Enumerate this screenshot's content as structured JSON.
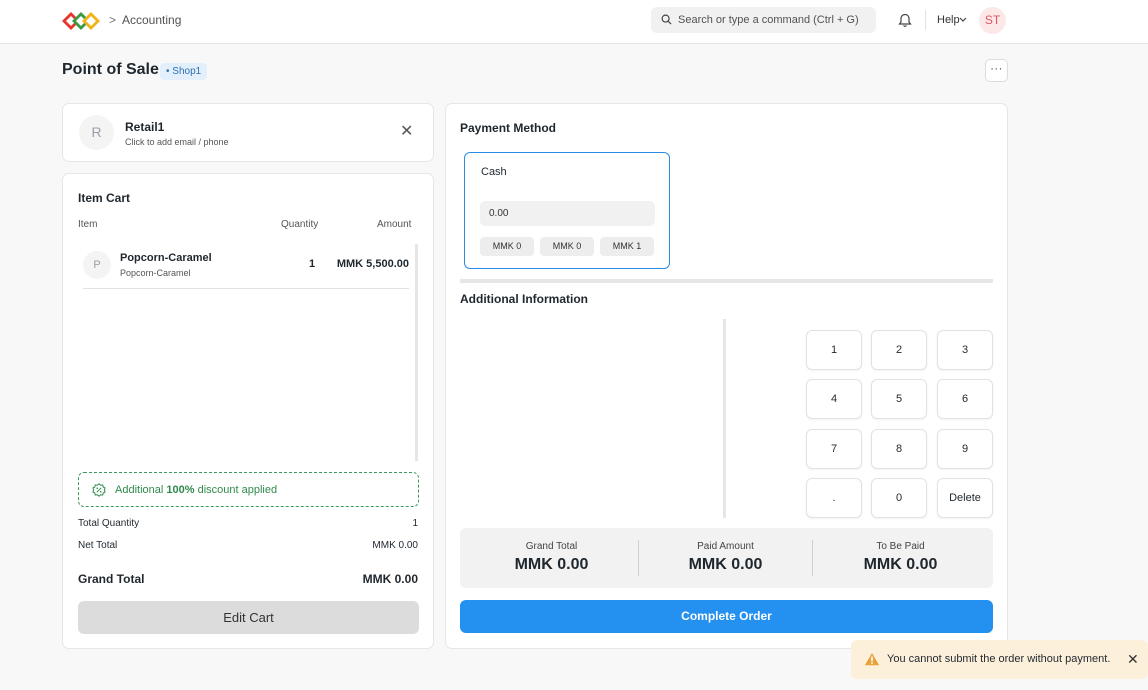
{
  "navbar": {
    "breadcrumb_sep": ">",
    "breadcrumb": "Accounting",
    "search_placeholder": "Search or type a command (Ctrl + G)",
    "help": "Help",
    "user_initials": "ST"
  },
  "page": {
    "title": "Point of Sale",
    "badge": "• Shop1",
    "more": "···"
  },
  "customer": {
    "initial": "R",
    "name": "Retail1",
    "subtitle": "Click to add email / phone",
    "close": "✕"
  },
  "cart": {
    "title": "Item Cart",
    "headers": {
      "item": "Item",
      "quantity": "Quantity",
      "amount": "Amount"
    },
    "items": [
      {
        "initial": "P",
        "name": "Popcorn-Caramel",
        "code": "Popcorn-Caramel",
        "qty": "1",
        "amount": "MMK 5,500.00"
      }
    ],
    "discount": {
      "prefix": "Additional ",
      "percent": "100%",
      "suffix": " discount applied"
    },
    "total_quantity_label": "Total Quantity",
    "total_quantity": "1",
    "net_total_label": "Net Total",
    "net_total": "MMK 0.00",
    "grand_total_label": "Grand Total",
    "grand_total": "MMK 0.00",
    "edit_button": "Edit Cart"
  },
  "payment": {
    "title": "Payment Method",
    "method": "Cash",
    "amount": "0.00",
    "quick_amounts": [
      "MMK 0",
      "MMK 0",
      "MMK 1"
    ],
    "additional_title": "Additional Information",
    "numpad": [
      "1",
      "2",
      "3",
      "4",
      "5",
      "6",
      "7",
      "8",
      "9",
      ".",
      "0",
      "Delete"
    ],
    "summary": {
      "grand_total_label": "Grand Total",
      "grand_total": "MMK 0.00",
      "paid_label": "Paid Amount",
      "paid": "MMK 0.00",
      "to_be_paid_label": "To Be Paid",
      "to_be_paid": "MMK 0.00"
    },
    "complete_button": "Complete Order"
  },
  "toast": {
    "message": "You cannot submit the order without payment.",
    "close": "✕"
  },
  "colors": {
    "primary": "#2490ef",
    "success": "#2f8a4c",
    "warning_bg": "#fdf0db",
    "warning_icon": "#e8a33d",
    "avatar_bg": "#fde8e8",
    "avatar_text": "#e05666"
  }
}
